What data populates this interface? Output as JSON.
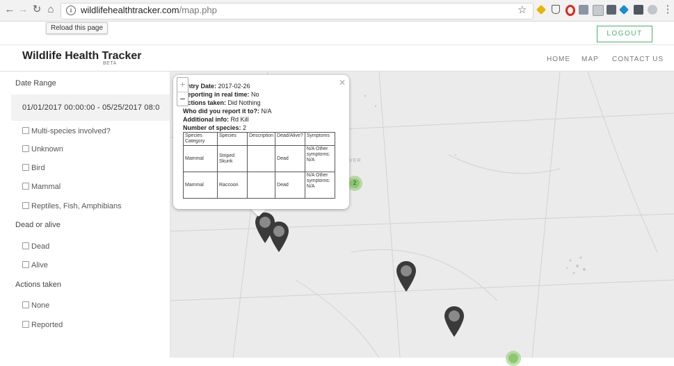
{
  "browser": {
    "url_domain": "wildlifehealthtracker.com",
    "url_path": "/map.php",
    "tooltip": "Reload this page"
  },
  "header": {
    "logout_label": "LOGOUT",
    "brand": "Wildlife Health Tracker",
    "beta": "BETA",
    "nav": [
      "HOME",
      "MAP",
      "CONTACT US"
    ]
  },
  "sidebar": {
    "date_range_title": "Date Range",
    "date_range_value": "01/01/2017 00:00:00 - 05/25/2017 08:0",
    "multi_species": "Multi-species involved?",
    "species_options": [
      "Unknown",
      "Bird",
      "Mammal",
      "Reptiles, Fish, Amphibians"
    ],
    "dead_or_alive_title": "Dead or alive",
    "dead_or_alive_options": [
      "Dead",
      "Alive"
    ],
    "actions_title": "Actions taken",
    "actions_options": [
      "None",
      "Reported"
    ]
  },
  "popup": {
    "entry_date_label": "Entry Date:",
    "entry_date": "2017-02-26",
    "realtime_label": "Reporting in real time:",
    "realtime": "No",
    "actions_label": "Actions taken:",
    "actions": "Did Nothing",
    "reported_to_label": "Who did you report it to?:",
    "reported_to": "N/A",
    "additional_label": "Additional info:",
    "additional": "Rd Kill",
    "num_species_label": "Number of species:",
    "num_species": "2",
    "table_headers": [
      "Species Category",
      "Species",
      "Description",
      "Dead/Alive?",
      "Symptoms"
    ],
    "rows": [
      [
        "Mammal",
        "Striped Skunk",
        "",
        "Dead",
        "N/A Other symptoms: N/A"
      ],
      [
        "Mammal",
        "Raccoon",
        "",
        "Dead",
        "N/A Other symptoms: N/A"
      ]
    ]
  },
  "map": {
    "zoom_in": "+",
    "zoom_out": "−",
    "cluster_count": "2",
    "map_label": "VER"
  },
  "colors": {
    "accent": "#4caf6a",
    "marker": "#3a3a3a",
    "cluster": "#8cc86e"
  }
}
